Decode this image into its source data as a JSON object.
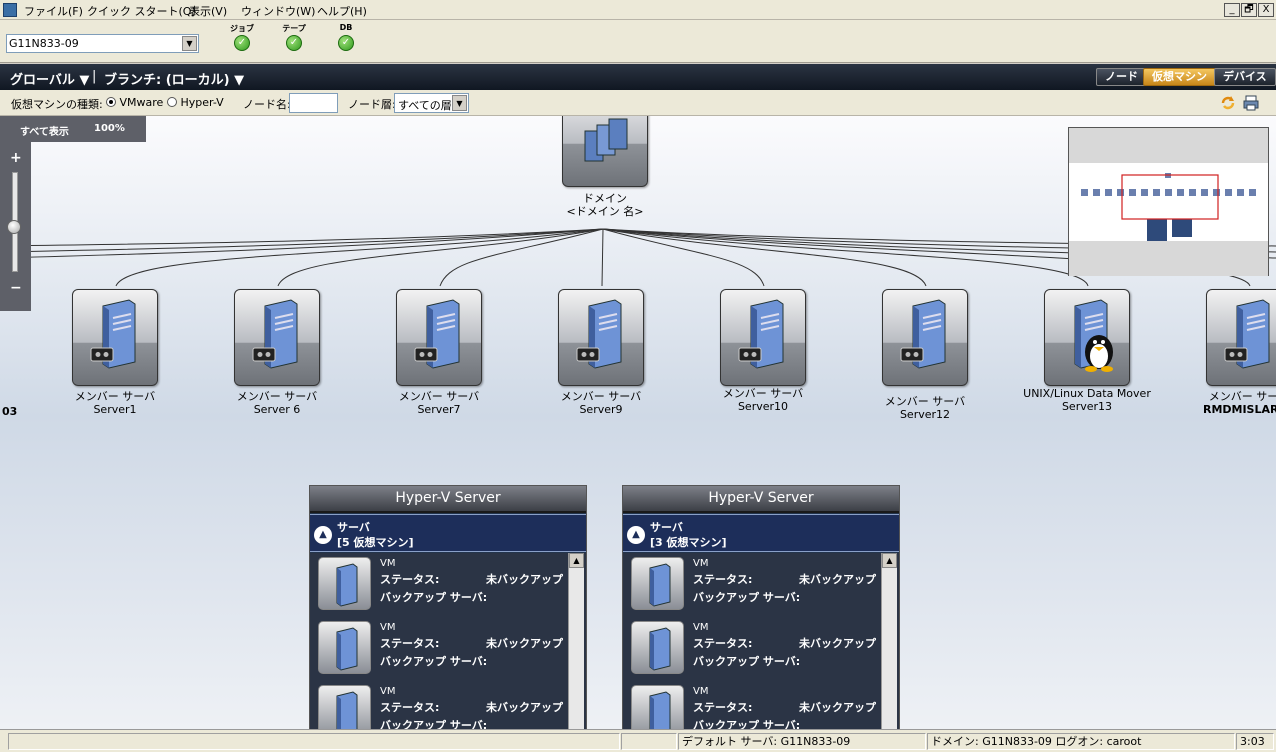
{
  "menu": {
    "items": [
      "ファイル(F)",
      "クイック スタート(Q)",
      "表示(V)",
      "ウィンドウ(W)",
      "ヘルプ(H)"
    ],
    "window_buttons": [
      "_",
      "🗗",
      "X"
    ]
  },
  "toolbar": {
    "server_value": "G11N833-09",
    "status_items": [
      {
        "label": "ジョブ",
        "icon": "check-circle-icon",
        "color": "#2f9a1c"
      },
      {
        "label": "テープ",
        "icon": "check-circle-icon",
        "color": "#2f9a1c"
      },
      {
        "label": "DB",
        "icon": "check-circle-icon",
        "color": "#2f9a1c"
      }
    ]
  },
  "nav": {
    "global": "グローバル ▼",
    "separator": "|",
    "branch": "ブランチ: (ローカル) ▼",
    "tabs": [
      {
        "label": "ノード",
        "active": false
      },
      {
        "label": "仮想マシン",
        "active": true
      },
      {
        "label": "デバイス",
        "active": false
      }
    ],
    "active_color": "#e0a030"
  },
  "filter": {
    "vm_type_label": "仮想マシンの種類:",
    "vmware": "VMware",
    "hyperv": "Hyper-V",
    "node_name_label": "ノード名:",
    "node_name_value": "",
    "layer_label": "ノード層:",
    "layer_value": "すべての層"
  },
  "zoom": {
    "show_all": "すべて表示",
    "percent": "100%",
    "plus": "+",
    "minus": "−",
    "level": 0.45
  },
  "domain_node": {
    "line1": "ドメイン",
    "line2": "<ドメイン 名>"
  },
  "nodes": [
    {
      "role": "メンバー サーバ",
      "name": "Server1",
      "os": "windows"
    },
    {
      "role": "メンバー サーバ",
      "name": "Server 6",
      "os": "windows"
    },
    {
      "role": "メンバー サーバ",
      "name": "Server7",
      "os": "windows"
    },
    {
      "role": "メンバー サーバ",
      "name": "Server9",
      "os": "windows"
    },
    {
      "role": "メンバー サーバ",
      "name": "Server10",
      "os": "windows"
    },
    {
      "role": "メンバー サーバ",
      "name": "Server12",
      "os": "windows"
    },
    {
      "role": "UNIX/Linux Data Mover",
      "name": "Server13",
      "os": "linux"
    },
    {
      "role": "メンバー サーバ",
      "name": "RMDMISLARCR",
      "os": "windows"
    }
  ],
  "left_edge_label": "03",
  "hyperv_panels": [
    {
      "title": "Hyper-V Server",
      "server_line1": "サーバ",
      "server_line2": "[5 仮想マシン]",
      "vms": [
        {
          "type": "VM",
          "status_label": "ステータス:",
          "status": "未バックアップ",
          "backup_label": "バックアップ サーバ:"
        },
        {
          "type": "VM",
          "status_label": "ステータス:",
          "status": "未バックアップ",
          "backup_label": "バックアップ サーバ:"
        },
        {
          "type": "VM",
          "status_label": "ステータス:",
          "status": "未バックアップ",
          "backup_label": "バックアップ サーバ:"
        }
      ]
    },
    {
      "title": "Hyper-V Server",
      "server_line1": "サーバ",
      "server_line2": "[3 仮想マシン]",
      "vms": [
        {
          "type": "VM",
          "status_label": "ステータス:",
          "status": "未バックアップ",
          "backup_label": "バックアップ サーバ:"
        },
        {
          "type": "VM",
          "status_label": "ステータス:",
          "status": "未バックアップ",
          "backup_label": "バックアップ サーバ:"
        },
        {
          "type": "VM",
          "status_label": "ステータス:",
          "status": "未バックアップ",
          "backup_label": "バックアップ サーバ:"
        }
      ]
    }
  ],
  "statusbar": {
    "default_server": "デフォルト サーバ: G11N833-09",
    "domain_logon": "ドメイン: G11N833-09  ログオン: caroot",
    "time": "3:03"
  }
}
